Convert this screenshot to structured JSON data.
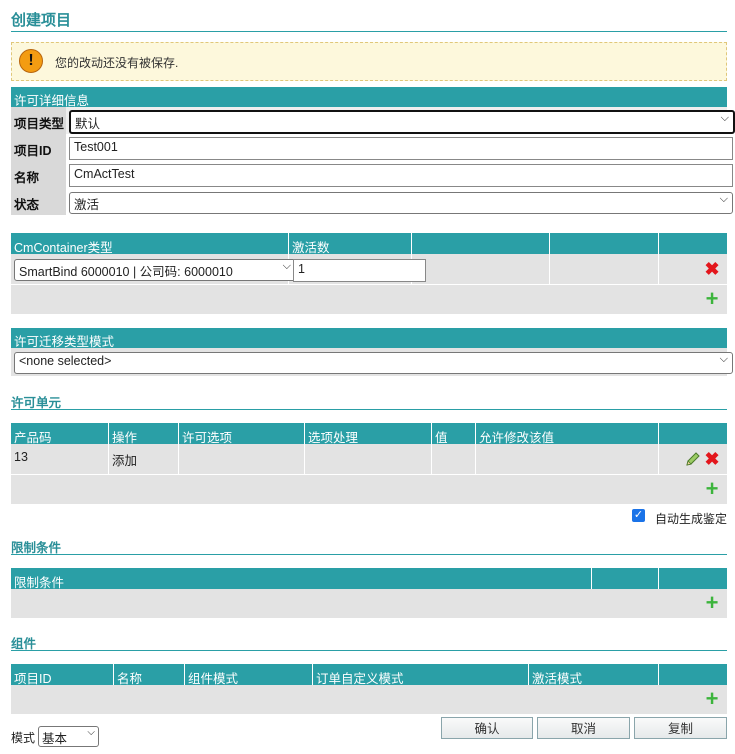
{
  "page": {
    "title": "创建项目"
  },
  "warning": {
    "text": "您的改动还没有被保存."
  },
  "license_details": {
    "header": "许可详细信息",
    "project_type_label": "项目类型",
    "project_type_value": "默认",
    "project_id_label": "项目ID",
    "project_id_value": "Test001",
    "name_label": "名称",
    "name_value": "CmActTest",
    "status_label": "状态",
    "status_value": "激活"
  },
  "container_table": {
    "col_type": "CmContainer类型",
    "col_activations": "激活数",
    "row": {
      "type_value": "SmartBind 6000010 | 公司码: 6000010",
      "activations_value": "1"
    }
  },
  "migration": {
    "header": "许可迁移类型模式",
    "value": "<none selected>"
  },
  "license_units": {
    "title": "许可单元",
    "columns": [
      "产品码",
      "操作",
      "许可选项",
      "选项处理",
      "值",
      "允许修改该值"
    ],
    "rows": [
      {
        "product_code": "13",
        "operation": "添加"
      }
    ],
    "auto_generate_label": "自动生成鉴定",
    "auto_generate_checked": true
  },
  "restrictions": {
    "title": "限制条件",
    "column": "限制条件"
  },
  "components": {
    "title": "组件",
    "columns": [
      "项目ID",
      "名称",
      "组件模式",
      "订单自定义模式",
      "激活模式"
    ]
  },
  "footer": {
    "mode_label": "模式",
    "mode_value": "基本",
    "confirm_label": "确认",
    "cancel_label": "取消",
    "copy_label": "复制"
  },
  "icons": {
    "warning": "warning-icon",
    "delete": "delete-icon",
    "add": "add-icon",
    "edit": "pencil-icon"
  },
  "colors": {
    "accent": "#2a9fa6",
    "delete": "#e3161c",
    "add": "#3cb43c",
    "warning_bg": "#fdf8dc"
  }
}
